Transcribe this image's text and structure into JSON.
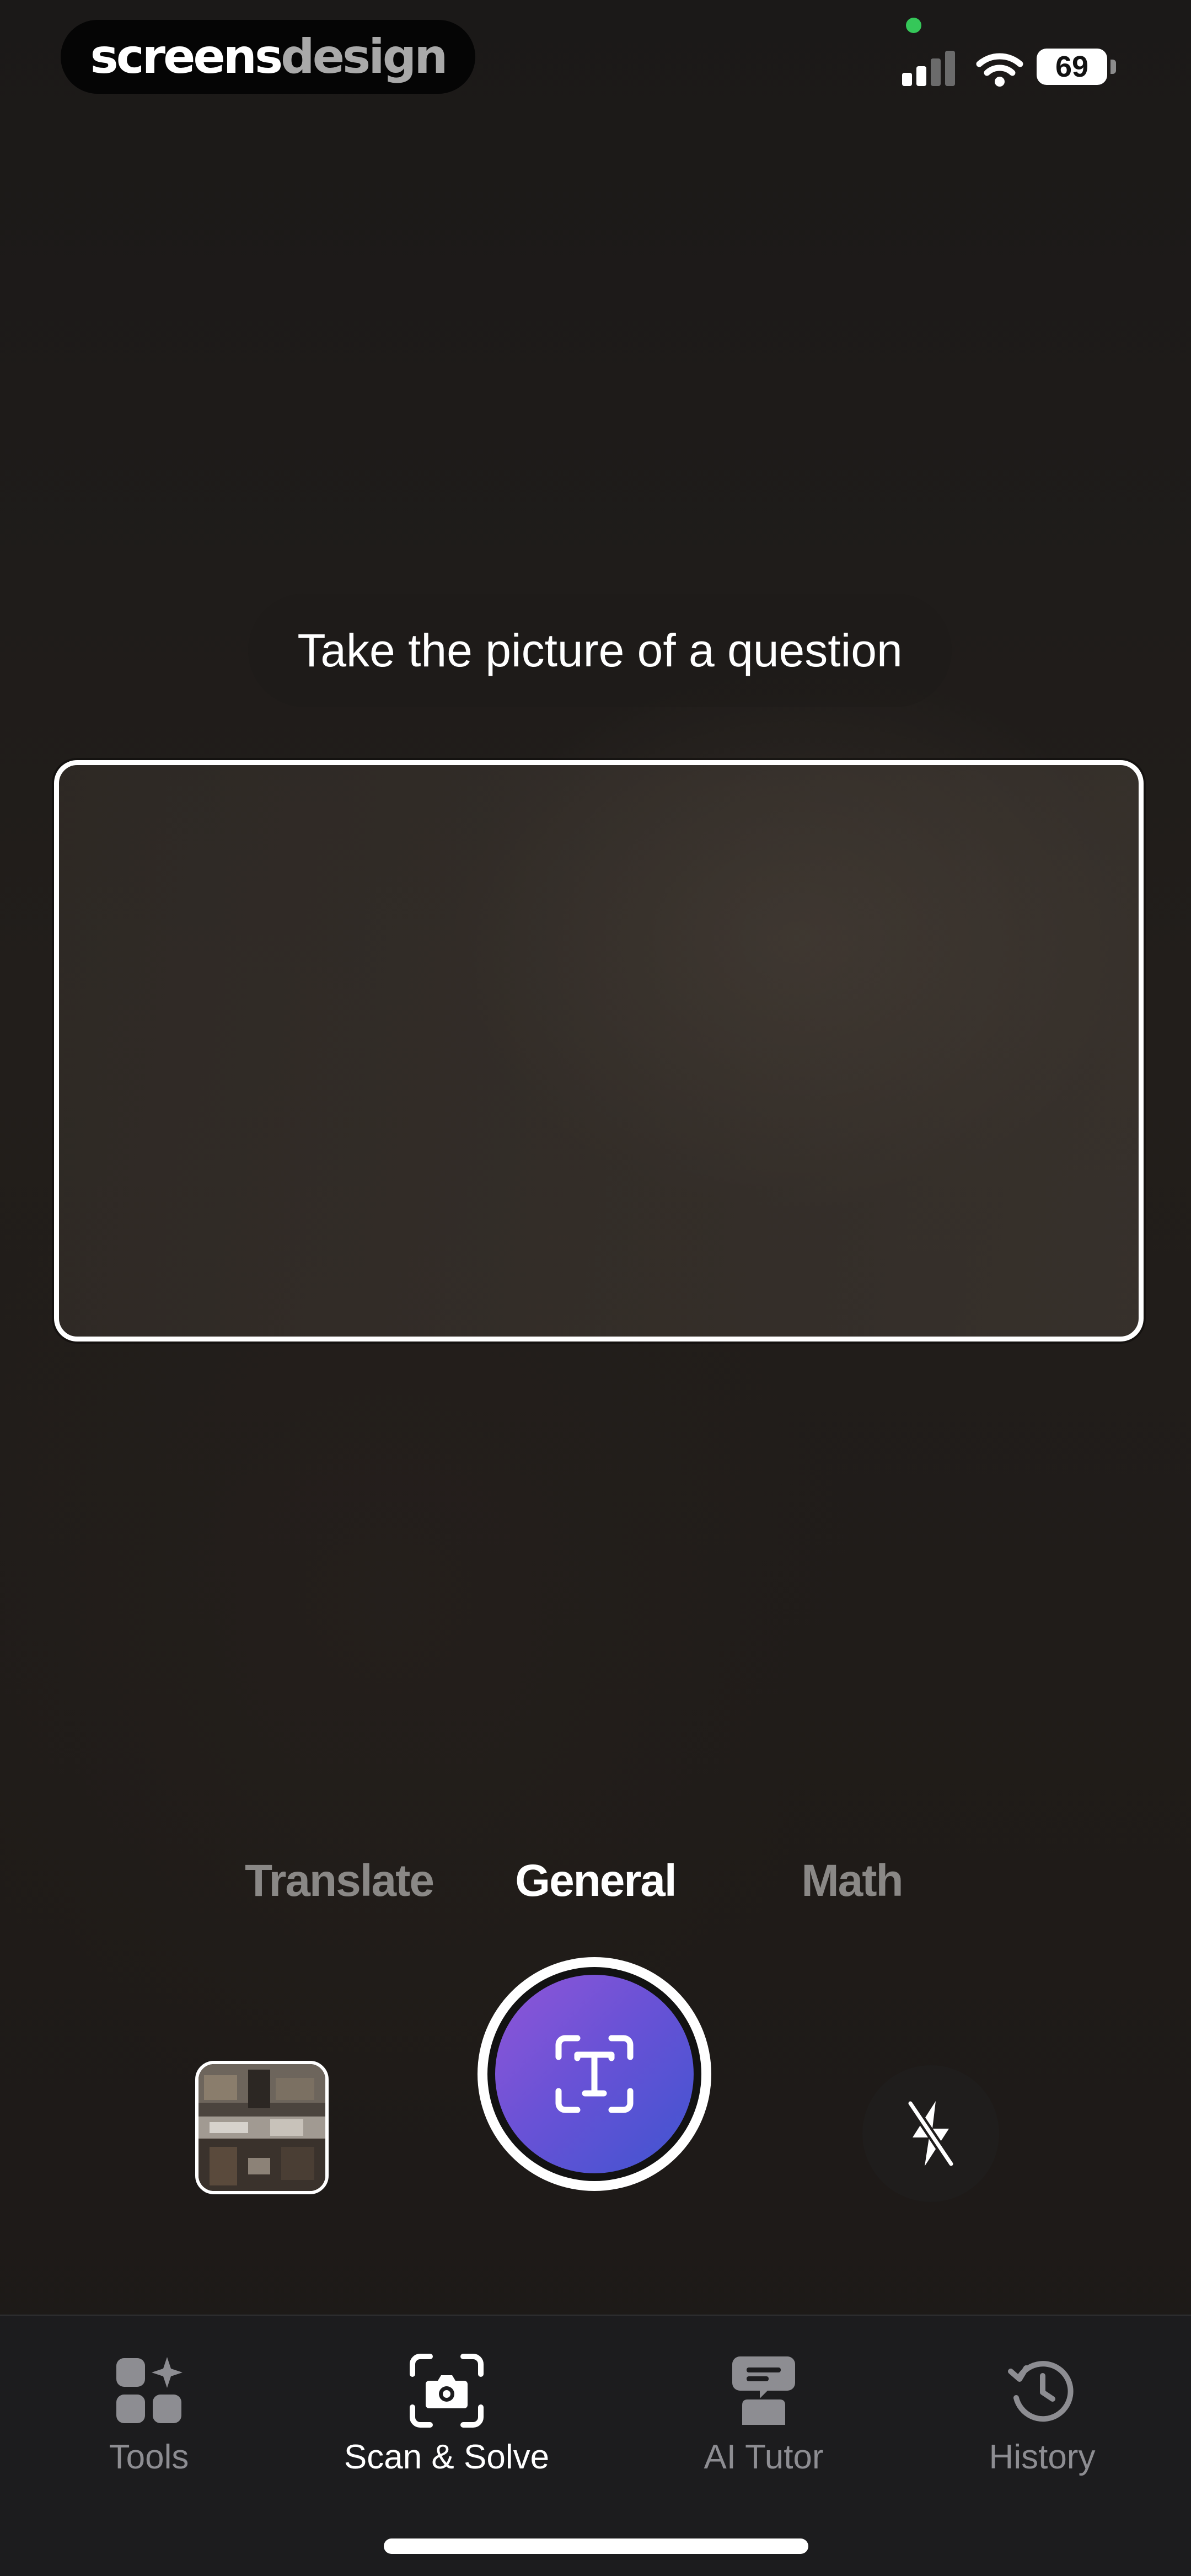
{
  "status_bar": {
    "watermark_primary": "screens",
    "watermark_secondary": "design",
    "battery_level": "69",
    "signal_bars_active": 2,
    "signal_bars_total": 4,
    "privacy_indicator_color": "#35c759",
    "icons": [
      "signal-icon",
      "wifi-icon",
      "battery-icon"
    ]
  },
  "camera": {
    "prompt_text": "Take the picture of a question",
    "modes": [
      {
        "label": "Translate",
        "active": false
      },
      {
        "label": "General",
        "active": true
      },
      {
        "label": "Math",
        "active": false
      }
    ],
    "shutter_icon": "text-scan-icon",
    "shutter_gradient": [
      "#9056d8",
      "#3f54d0"
    ],
    "gallery_icon": "gallery-thumbnail",
    "flash_icon": "flash-off-icon"
  },
  "tab_bar": {
    "tabs": [
      {
        "label": "Tools",
        "icon": "tools-grid-icon",
        "active": false
      },
      {
        "label": "Scan & Solve",
        "icon": "camera-scan-icon",
        "active": true
      },
      {
        "label": "AI Tutor",
        "icon": "ai-tutor-icon",
        "active": false
      },
      {
        "label": "History",
        "icon": "history-icon",
        "active": false
      }
    ]
  },
  "colors": {
    "background": "#1e1b19",
    "active_text": "#ffffff",
    "inactive_text": "#8d8d92",
    "tab_bar_background": "#1c1c1e"
  }
}
